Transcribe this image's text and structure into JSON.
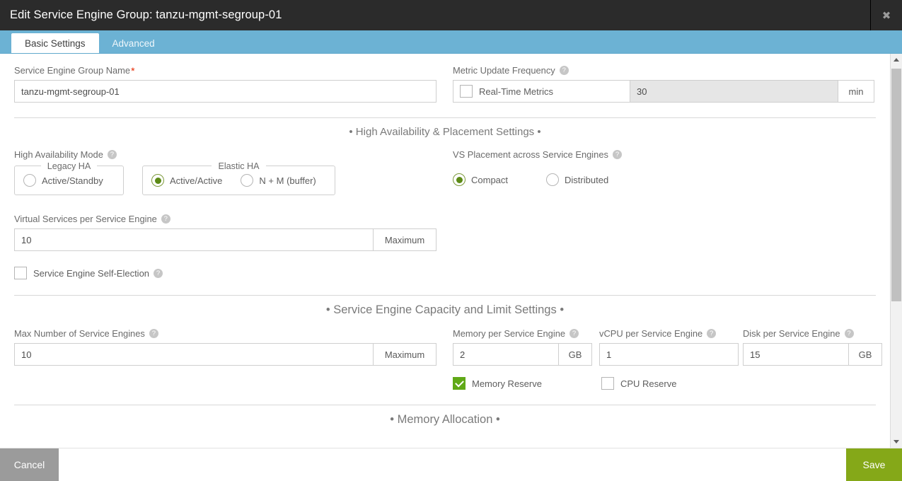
{
  "window": {
    "title": "Edit Service Engine Group: tanzu-mgmt-segroup-01",
    "close_icon": "close-icon",
    "close_glyph": "✖"
  },
  "tabs": [
    {
      "label": "Basic Settings",
      "active": true
    },
    {
      "label": "Advanced",
      "active": false
    }
  ],
  "help_glyph": "?",
  "form": {
    "se_group_name": {
      "label": "Service Engine Group Name",
      "required_marker": "*",
      "value": "tanzu-mgmt-segroup-01"
    },
    "metric_update_frequency": {
      "label": "Metric Update Frequency",
      "realtime_label": "Real-Time Metrics",
      "realtime_checked": false,
      "value": "30",
      "unit": "min",
      "value_disabled": true
    }
  },
  "sections": {
    "ha_placement": "• High Availability & Placement Settings •",
    "se_capacity": "•  Service Engine Capacity and Limit Settings  •",
    "memory_allocation": "•  Memory Allocation  •"
  },
  "ha": {
    "mode_label": "High Availability Mode",
    "legacy_legend": "Legacy HA",
    "elastic_legend": "Elastic HA",
    "options": [
      {
        "label": "Active/Standby",
        "selected": false,
        "group": "legacy"
      },
      {
        "label": "Active/Active",
        "selected": true,
        "group": "elastic"
      },
      {
        "label": "N + M (buffer)",
        "selected": false,
        "group": "elastic"
      }
    ]
  },
  "vs_placement": {
    "label": "VS Placement across Service Engines",
    "options": [
      {
        "label": "Compact",
        "selected": true
      },
      {
        "label": "Distributed",
        "selected": false
      }
    ]
  },
  "virtual_services_per_se": {
    "label": "Virtual Services per Service Engine",
    "value": "10",
    "addon": "Maximum"
  },
  "se_self_election": {
    "label": "Service Engine Self-Election",
    "checked": false
  },
  "capacity": {
    "max_se": {
      "label": "Max Number of Service Engines",
      "value": "10",
      "addon": "Maximum"
    },
    "memory_per_se": {
      "label": "Memory per Service Engine",
      "value": "2",
      "unit": "GB"
    },
    "vcpu_per_se": {
      "label": "vCPU per Service Engine",
      "value": "1"
    },
    "disk_per_se": {
      "label": "Disk per Service Engine",
      "value": "15",
      "unit": "GB"
    },
    "memory_reserve": {
      "label": "Memory Reserve",
      "checked": true
    },
    "cpu_reserve": {
      "label": "CPU Reserve",
      "checked": false
    }
  },
  "footer": {
    "cancel_label": "Cancel",
    "save_label": "Save"
  },
  "colors": {
    "title_bar": "#2b2b2b",
    "tab_bar": "#6cb2d4",
    "accent_green": "#60a917",
    "save_button": "#85a818",
    "cancel_button": "#9b9b9b",
    "required_star": "#e62700"
  }
}
